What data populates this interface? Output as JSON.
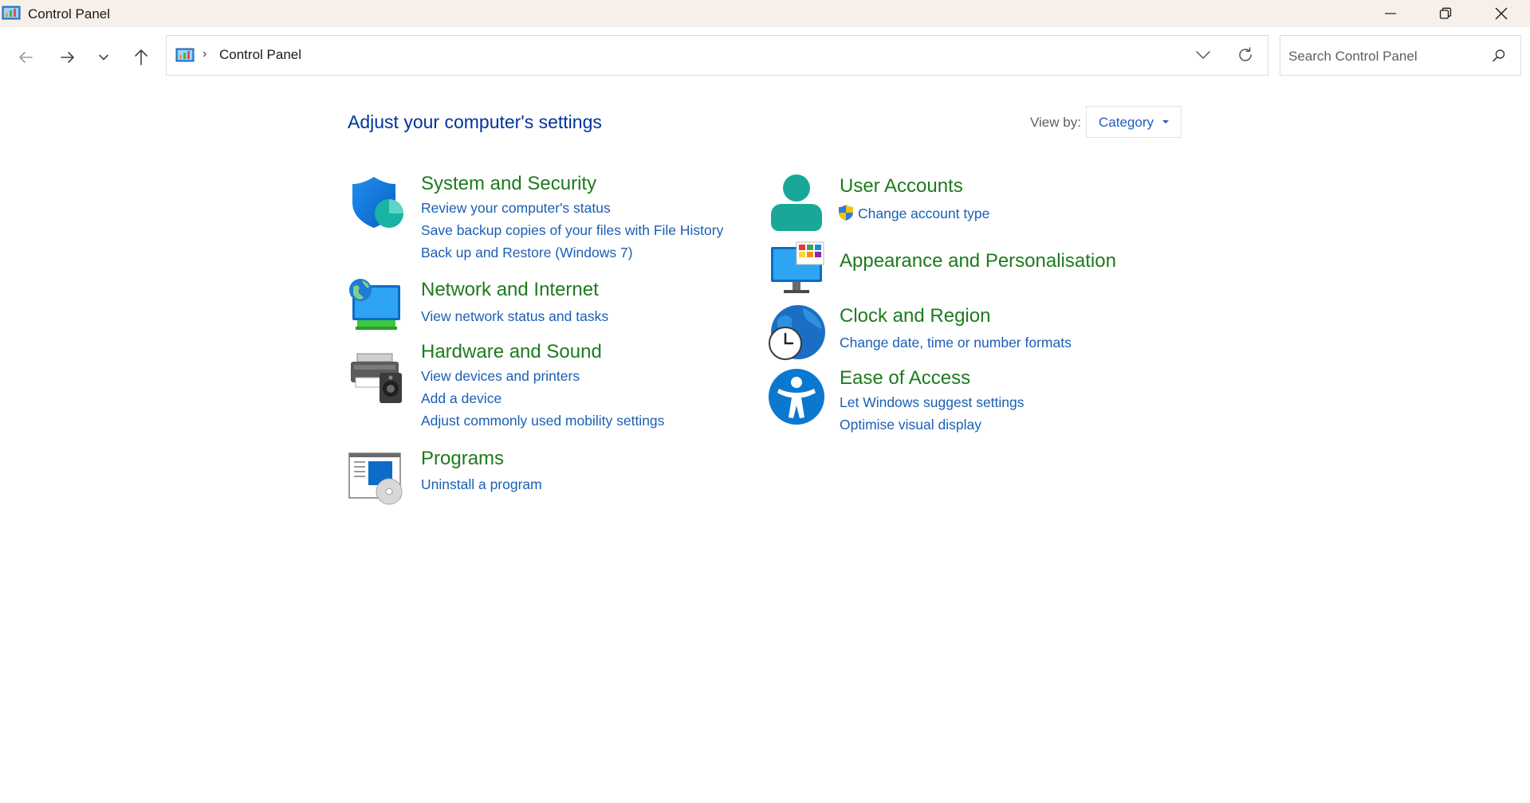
{
  "window": {
    "title": "Control Panel",
    "icon": "control-panel-icon",
    "controls": [
      "minimize-icon",
      "restore-icon",
      "close-icon"
    ]
  },
  "nav": {
    "buttons": [
      "back-arrow-icon",
      "forward-arrow-icon",
      "recent-locations-chevron-icon",
      "up-arrow-icon"
    ],
    "address": {
      "separator": "›",
      "path": "Control Panel"
    },
    "search": {
      "placeholder": "Search Control Panel",
      "value": ""
    }
  },
  "content": {
    "heading": "Adjust your computer's settings",
    "view_by": {
      "label": "View by:",
      "selected": "Category"
    },
    "categories": [
      {
        "title": "System and Security",
        "icon": "shield-icon",
        "links": [
          "Review your computer's status",
          "Save backup copies of your files with File History",
          "Back up and Restore (Windows 7)"
        ]
      },
      {
        "title": "Network and Internet",
        "icon": "network-globe-icon",
        "links": [
          "View network status and tasks"
        ]
      },
      {
        "title": "Hardware and Sound",
        "icon": "printer-speaker-icon",
        "links": [
          "View devices and printers",
          "Add a device",
          "Adjust commonly used mobility settings"
        ]
      },
      {
        "title": "Programs",
        "icon": "programs-disc-icon",
        "links": [
          "Uninstall a program"
        ]
      },
      {
        "title": "User Accounts",
        "icon": "user-icon",
        "links": [
          "Change account type"
        ]
      },
      {
        "title": "Appearance and Personalisation",
        "icon": "monitor-palette-icon",
        "links": []
      },
      {
        "title": "Clock and Region",
        "icon": "clock-globe-icon",
        "links": [
          "Change date, time or number formats"
        ]
      },
      {
        "title": "Ease of Access",
        "icon": "accessibility-icon",
        "links": [
          "Let Windows suggest settings",
          "Optimise visual display"
        ]
      }
    ]
  },
  "colors": {
    "titlebar_bg": "#f7efe9",
    "heading": "#003399",
    "category_title": "#1e7a1e",
    "link": "#1a5fb4"
  }
}
